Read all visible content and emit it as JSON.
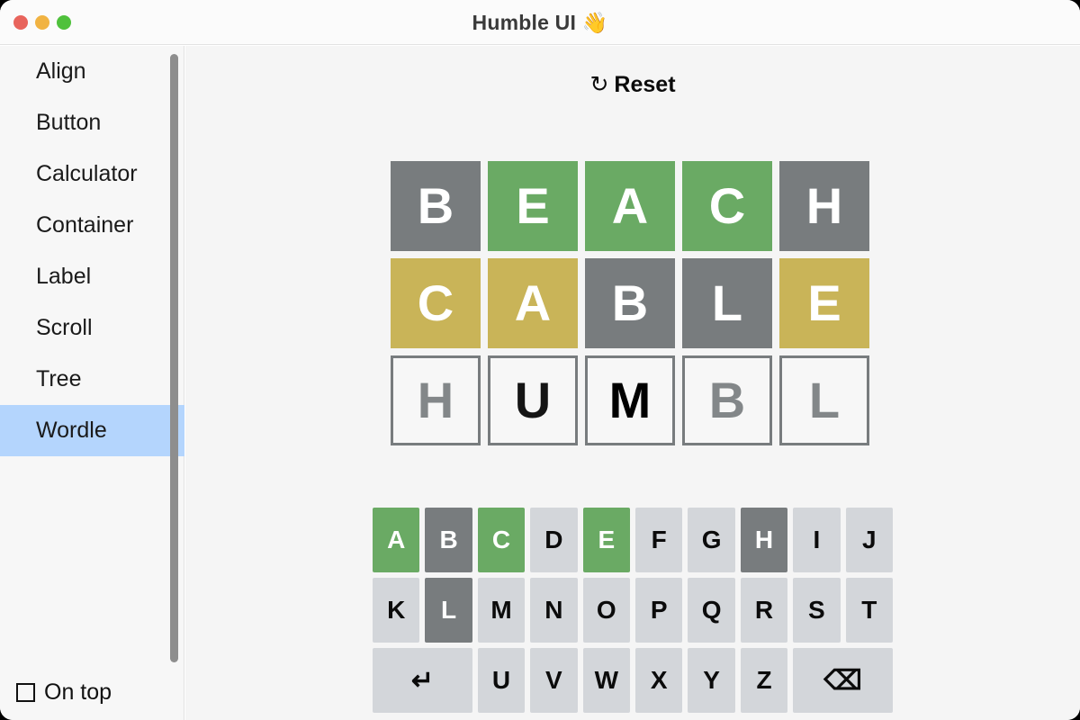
{
  "window": {
    "title": "Humble UI 👋",
    "traffic_lights": [
      {
        "name": "close",
        "color": "#e8645c"
      },
      {
        "name": "minimize",
        "color": "#f1b342"
      },
      {
        "name": "maximize",
        "color": "#4fc13c"
      }
    ]
  },
  "sidebar": {
    "items": [
      {
        "label": "Align",
        "selected": false
      },
      {
        "label": "Button",
        "selected": false
      },
      {
        "label": "Calculator",
        "selected": false
      },
      {
        "label": "Container",
        "selected": false
      },
      {
        "label": "Label",
        "selected": false
      },
      {
        "label": "Scroll",
        "selected": false
      },
      {
        "label": "Tree",
        "selected": false
      },
      {
        "label": "Wordle",
        "selected": true
      }
    ],
    "selected_color": "#b4d5fd",
    "on_top": {
      "label": "On top",
      "checked": false,
      "icon": "checkbox-unchecked-icon"
    }
  },
  "main": {
    "reset": {
      "label": "Reset",
      "icon": "↻",
      "icon_name": "refresh-icon"
    },
    "colors": {
      "correct": "#6aaa64",
      "present": "#c9b458",
      "absent": "#787c7e",
      "key_default": "#d3d6da"
    },
    "board": {
      "rows": [
        {
          "word": "BEACH",
          "tiles": [
            {
              "letter": "B",
              "state": "absent",
              "bg": "#787c7e",
              "fg": "#ffffff"
            },
            {
              "letter": "E",
              "state": "correct",
              "bg": "#6aaa64",
              "fg": "#ffffff"
            },
            {
              "letter": "A",
              "state": "correct",
              "bg": "#6aaa64",
              "fg": "#ffffff"
            },
            {
              "letter": "C",
              "state": "correct",
              "bg": "#6aaa64",
              "fg": "#ffffff"
            },
            {
              "letter": "H",
              "state": "absent",
              "bg": "#787c7e",
              "fg": "#ffffff"
            }
          ]
        },
        {
          "word": "CABLE",
          "tiles": [
            {
              "letter": "C",
              "state": "present",
              "bg": "#c9b458",
              "fg": "#ffffff"
            },
            {
              "letter": "A",
              "state": "present",
              "bg": "#c9b458",
              "fg": "#ffffff"
            },
            {
              "letter": "B",
              "state": "absent",
              "bg": "#787c7e",
              "fg": "#ffffff"
            },
            {
              "letter": "L",
              "state": "absent",
              "bg": "#787c7e",
              "fg": "#ffffff"
            },
            {
              "letter": "E",
              "state": "present",
              "bg": "#c9b458",
              "fg": "#ffffff"
            }
          ]
        },
        {
          "word": "HUMBL",
          "tiles": [
            {
              "letter": "H",
              "state": "typing",
              "bg": "#f7f7f7",
              "fg": "#838789"
            },
            {
              "letter": "U",
              "state": "typing",
              "bg": "#f7f7f7",
              "fg": "#151515"
            },
            {
              "letter": "M",
              "state": "typing",
              "bg": "#f7f7f7",
              "fg": "#000000"
            },
            {
              "letter": "B",
              "state": "typing",
              "bg": "#f7f7f7",
              "fg": "#838789"
            },
            {
              "letter": "L",
              "state": "typing",
              "bg": "#f7f7f7",
              "fg": "#838789"
            }
          ]
        }
      ]
    },
    "keyboard": {
      "rows": [
        [
          {
            "label": "A",
            "key": "A",
            "state": "correct"
          },
          {
            "label": "B",
            "key": "B",
            "state": "absent"
          },
          {
            "label": "C",
            "key": "C",
            "state": "correct"
          },
          {
            "label": "D",
            "key": "D",
            "state": "default"
          },
          {
            "label": "E",
            "key": "E",
            "state": "correct"
          },
          {
            "label": "F",
            "key": "F",
            "state": "default"
          },
          {
            "label": "G",
            "key": "G",
            "state": "default"
          },
          {
            "label": "H",
            "key": "H",
            "state": "absent"
          },
          {
            "label": "I",
            "key": "I",
            "state": "default"
          },
          {
            "label": "J",
            "key": "J",
            "state": "default"
          }
        ],
        [
          {
            "label": "K",
            "key": "K",
            "state": "default"
          },
          {
            "label": "L",
            "key": "L",
            "state": "absent"
          },
          {
            "label": "M",
            "key": "M",
            "state": "default"
          },
          {
            "label": "N",
            "key": "N",
            "state": "default"
          },
          {
            "label": "O",
            "key": "O",
            "state": "default"
          },
          {
            "label": "P",
            "key": "P",
            "state": "default"
          },
          {
            "label": "Q",
            "key": "Q",
            "state": "default"
          },
          {
            "label": "R",
            "key": "R",
            "state": "default"
          },
          {
            "label": "S",
            "key": "S",
            "state": "default"
          },
          {
            "label": "T",
            "key": "T",
            "state": "default"
          }
        ],
        [
          {
            "label": "↵",
            "key": "Enter",
            "state": "default",
            "wide": true,
            "icon_name": "enter-icon"
          },
          {
            "label": "U",
            "key": "U",
            "state": "default"
          },
          {
            "label": "V",
            "key": "V",
            "state": "default"
          },
          {
            "label": "W",
            "key": "W",
            "state": "default"
          },
          {
            "label": "X",
            "key": "X",
            "state": "default"
          },
          {
            "label": "Y",
            "key": "Y",
            "state": "default"
          },
          {
            "label": "Z",
            "key": "Z",
            "state": "default"
          },
          {
            "label": "⌫",
            "key": "Backspace",
            "state": "default",
            "wide": true,
            "icon_name": "backspace-icon"
          }
        ]
      ]
    }
  }
}
